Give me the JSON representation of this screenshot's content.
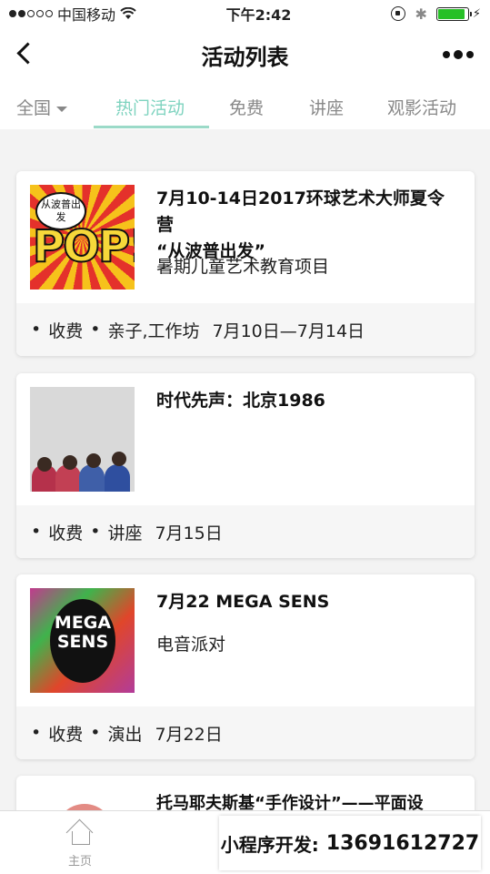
{
  "status_bar": {
    "carrier": "中国移动",
    "time": "下午2:42",
    "battery_level": 0.9
  },
  "nav": {
    "title": "活动列表"
  },
  "tabs": [
    {
      "label": "全国"
    },
    {
      "label": "热门活动"
    },
    {
      "label": "免费"
    },
    {
      "label": "讲座"
    },
    {
      "label": "观影活动"
    }
  ],
  "cards": [
    {
      "title_line1": "7月10-14日2017环球艺术大师夏令营",
      "title_line2": "“从波普出发”",
      "subtitle": "暑期儿童艺术教育项目",
      "fee": "收费",
      "tags": "亲子,工作坊",
      "date": "7月10日—7月14日",
      "thumb_bubble": "从波普出发",
      "thumb_text": "POP!"
    },
    {
      "title_line1": "时代先声：北京1986",
      "title_line2": "",
      "subtitle": "",
      "fee": "收费",
      "tags": "讲座",
      "date": "7月15日"
    },
    {
      "title_line1": "7月22 MEGA SENS",
      "title_line2": "",
      "subtitle": "电音派对",
      "fee": "收费",
      "tags": "演出",
      "date": "7月22日",
      "thumb_text_line1": "MEGA",
      "thumb_text_line2": "SENS"
    },
    {
      "title_line1": "托马耶夫斯基“手作设计”——平面设",
      "title_line2": ""
    }
  ],
  "tabbar": {
    "home_label": "主页"
  },
  "promo": {
    "label": "小程序开发:",
    "phone": "13691612727"
  },
  "colors": {
    "accent": "#7ed3bf",
    "underline": "#9bdac8",
    "card_footer": "#f6f6f6",
    "background": "#f3f3f3"
  }
}
